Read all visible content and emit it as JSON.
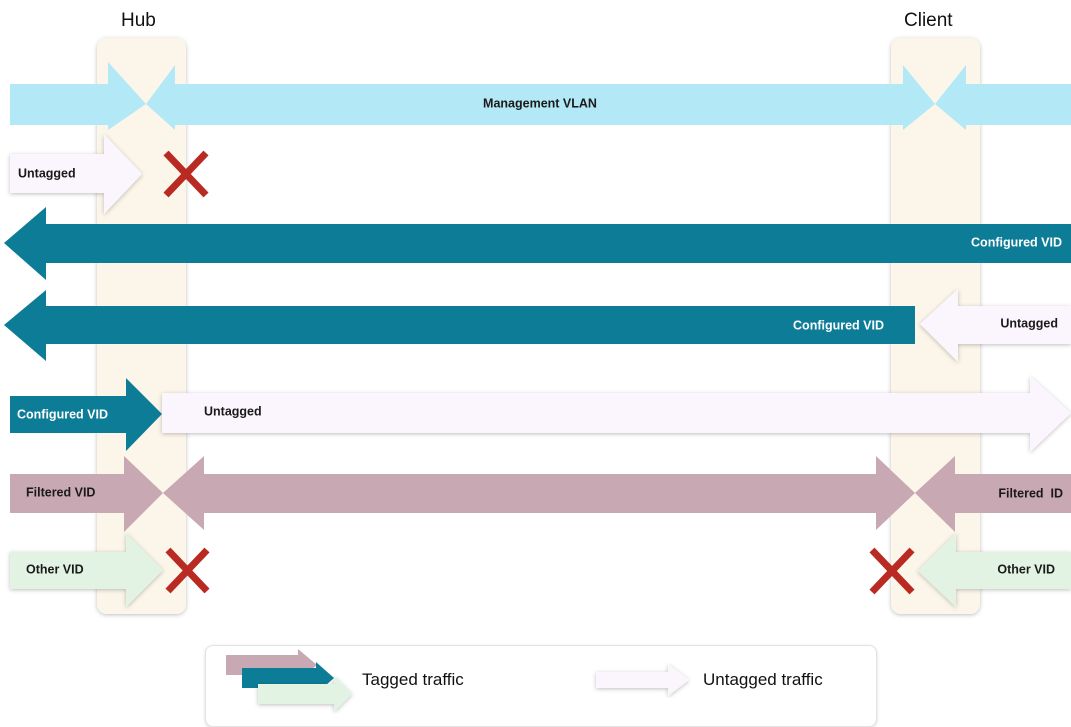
{
  "columns": {
    "hub": "Hub",
    "client": "Client"
  },
  "rows": {
    "management": "Management VLAN",
    "untagged_blocked": "Untagged",
    "configured_full": "Configured VID",
    "configured_hub_side": "Configured VID",
    "untagged_from_client": "Untagged",
    "configured_into_hub": "Configured VID",
    "untagged_out_of_hub": "Untagged",
    "filtered_left": "Filtered VID",
    "filtered_right": "Filtered  ID",
    "other_left": "Other VID",
    "other_right": "Other VID"
  },
  "legend": {
    "tagged": "Tagged traffic",
    "untagged": "Untagged traffic"
  },
  "colors": {
    "management": "#b3e8f7",
    "configured": "#0d7c97",
    "filtered": "#c8a9b3",
    "other": "#e3f3e3",
    "untagged": "#fbf6fd",
    "column": "#fbf6e9",
    "blocked_x": "#b82a22"
  }
}
